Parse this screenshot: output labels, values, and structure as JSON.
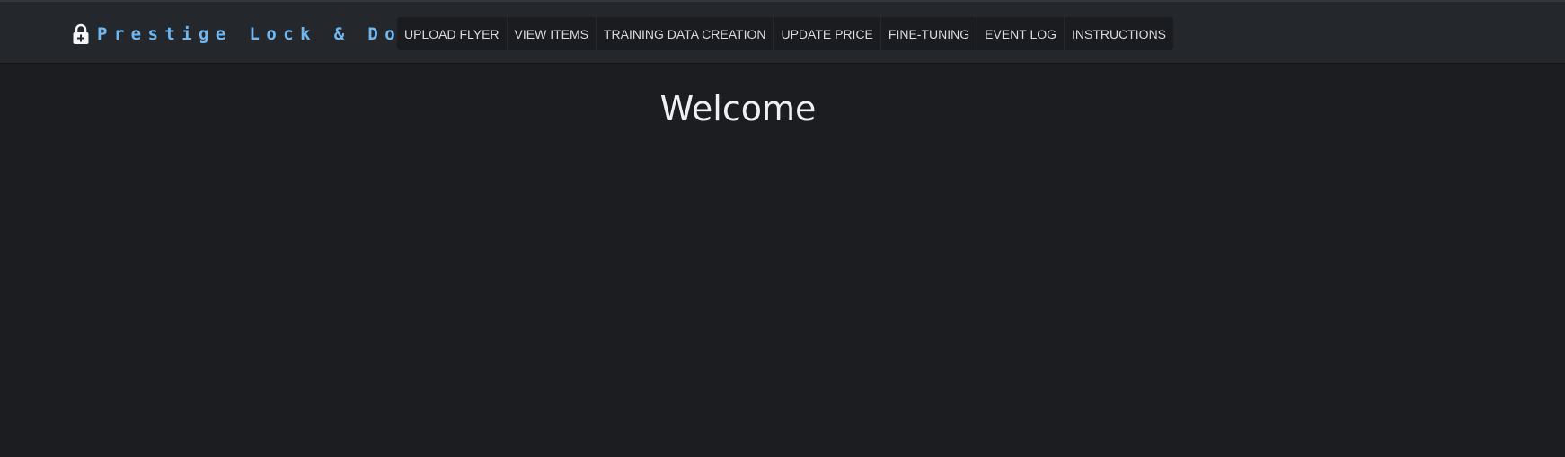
{
  "brand": {
    "name": "Prestige Lock & Door",
    "icon": "lock-icon",
    "color": "#70b8f2"
  },
  "nav": {
    "items": [
      {
        "label": "UPLOAD FLYER"
      },
      {
        "label": "VIEW ITEMS"
      },
      {
        "label": "TRAINING DATA CREATION"
      },
      {
        "label": "UPDATE PRICE"
      },
      {
        "label": "FINE-TUNING"
      },
      {
        "label": "EVENT LOG"
      },
      {
        "label": "INSTRUCTIONS"
      }
    ]
  },
  "main": {
    "heading": "Welcome"
  },
  "colors": {
    "background": "#1b1d20",
    "header": "#24282c",
    "nav_background": "#1a1c1f",
    "text": "#eef0f2"
  }
}
